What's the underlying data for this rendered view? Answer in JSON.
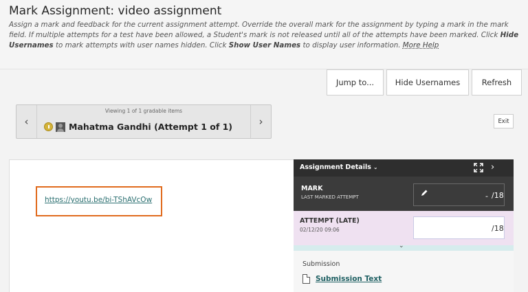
{
  "page": {
    "title": "Mark Assignment: video assignment",
    "instructions": {
      "part1": "Assign a mark and feedback for the current assignment attempt. Override the overall mark for the assignment by typing a mark in the mark field. If multiple attempts for a test have been allowed, a Student's mark is not released until all of the attempts have been marked. Click ",
      "hide_usernames": "Hide Usernames",
      "part2": " to mark attempts with user names hidden. Click ",
      "show_user_names": "Show User Names",
      "part3": " to display user information. ",
      "more_help": "More Help"
    }
  },
  "toolbar": {
    "jump_label": "Jump to...",
    "hide_usernames_label": "Hide Usernames",
    "refresh_label": "Refresh"
  },
  "navigator": {
    "viewing_text": "Viewing 1 of 1 gradable items",
    "prev_icon": "‹",
    "next_icon": "›",
    "student_name": "Mahatma Gandhi (Attempt 1 of 1)"
  },
  "exit_label": "Exit",
  "submission": {
    "link_text": "https://youtu.be/bi-TShAVcOw"
  },
  "panel": {
    "title": "Assignment Details",
    "caret": "⌄",
    "next_icon": "›",
    "mark": {
      "label": "MARK",
      "sublabel": "LAST MARKED ATTEMPT",
      "value": "-",
      "total": "/18"
    },
    "attempt": {
      "label": "ATTEMPT (LATE)",
      "date": "02/12/20 09:06",
      "total": "/18"
    },
    "collapse_icon": "⌄",
    "submission_heading": "Submission",
    "submission_text_link": "Submission Text"
  },
  "colors": {
    "highlight": "#e06a1c",
    "panel_dark": "#2e2e2e",
    "attempt_bg": "#efe1f1",
    "link": "#2a6f70"
  }
}
